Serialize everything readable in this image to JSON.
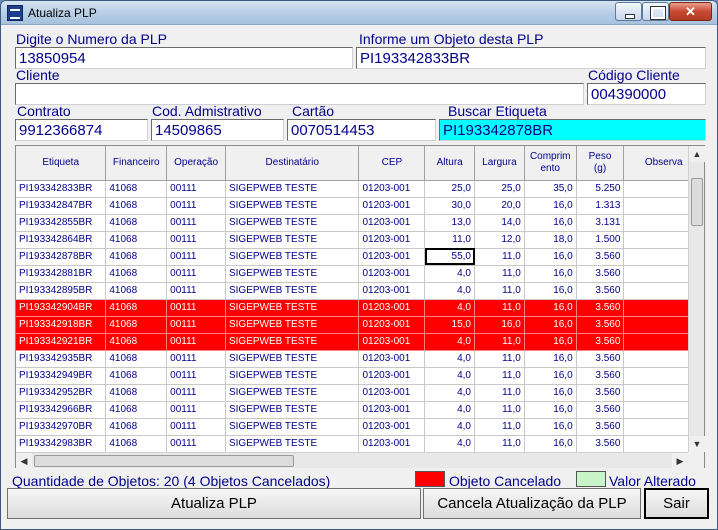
{
  "window": {
    "title": "Atualiza PLP"
  },
  "labels": {
    "plp_number": "Digite o Numero da PLP",
    "object": "Informe um Objeto desta PLP",
    "client": "Cliente",
    "client_code": "Código Cliente",
    "contract": "Contrato",
    "admin_code": "Cod. Admistrativo",
    "card": "Cartão",
    "search_label": "Buscar Etiqueta"
  },
  "fields": {
    "plp_number": "13850954",
    "object": "PI193342833BR",
    "client": "",
    "client_code": "004390000",
    "contract": "9912366874",
    "admin_code": "14509865",
    "card": "0070514453",
    "search_label": "PI193342878BR"
  },
  "table": {
    "columns": [
      {
        "label": "Etiqueta"
      },
      {
        "label": "Financeiro"
      },
      {
        "label": "Operação"
      },
      {
        "label": "Destinatário"
      },
      {
        "label": "CEP"
      },
      {
        "label": "Altura"
      },
      {
        "label": "Largura"
      },
      {
        "label": "Comprimento",
        "display": "Comprim\nento"
      },
      {
        "label": "Peso (g)",
        "display": "Peso\n(g)"
      },
      {
        "label": "Observa"
      }
    ],
    "rows": [
      {
        "cells": [
          "PI193342833BR",
          "41068",
          "00111",
          "SIGEPWEB TESTE",
          "01203-001",
          "25,0",
          "25,0",
          "35,0",
          "5.250",
          ""
        ],
        "status": "normal"
      },
      {
        "cells": [
          "PI193342847BR",
          "41068",
          "00111",
          "SIGEPWEB TESTE",
          "01203-001",
          "30,0",
          "20,0",
          "16,0",
          "1.313",
          ""
        ],
        "status": "normal"
      },
      {
        "cells": [
          "PI193342855BR",
          "41068",
          "00111",
          "SIGEPWEB TESTE",
          "01203-001",
          "13,0",
          "14,0",
          "16,0",
          "3.131",
          ""
        ],
        "status": "normal"
      },
      {
        "cells": [
          "PI193342864BR",
          "41068",
          "00111",
          "SIGEPWEB TESTE",
          "01203-001",
          "11,0",
          "12,0",
          "18,0",
          "1.500",
          ""
        ],
        "status": "normal"
      },
      {
        "cells": [
          "PI193342878BR",
          "41068",
          "00111",
          "SIGEPWEB TESTE",
          "01203-001",
          "55,0",
          "11,0",
          "16,0",
          "3.560",
          ""
        ],
        "status": "normal",
        "selected_col": 5
      },
      {
        "cells": [
          "PI193342881BR",
          "41068",
          "00111",
          "SIGEPWEB TESTE",
          "01203-001",
          "4,0",
          "11,0",
          "16,0",
          "3.560",
          ""
        ],
        "status": "normal"
      },
      {
        "cells": [
          "PI193342895BR",
          "41068",
          "00111",
          "SIGEPWEB TESTE",
          "01203-001",
          "4,0",
          "11,0",
          "16,0",
          "3.560",
          ""
        ],
        "status": "normal"
      },
      {
        "cells": [
          "PI193342904BR",
          "41068",
          "00111",
          "SIGEPWEB TESTE",
          "01203-001",
          "4,0",
          "11,0",
          "16,0",
          "3.560",
          ""
        ],
        "status": "cancelled"
      },
      {
        "cells": [
          "PI193342918BR",
          "41068",
          "00111",
          "SIGEPWEB TESTE",
          "01203-001",
          "15,0",
          "16,0",
          "16,0",
          "3.560",
          ""
        ],
        "status": "cancelled"
      },
      {
        "cells": [
          "PI193342921BR",
          "41068",
          "00111",
          "SIGEPWEB TESTE",
          "01203-001",
          "4,0",
          "11,0",
          "16,0",
          "3.560",
          ""
        ],
        "status": "cancelled"
      },
      {
        "cells": [
          "PI193342935BR",
          "41068",
          "00111",
          "SIGEPWEB TESTE",
          "01203-001",
          "4,0",
          "11,0",
          "16,0",
          "3.560",
          ""
        ],
        "status": "normal"
      },
      {
        "cells": [
          "PI193342949BR",
          "41068",
          "00111",
          "SIGEPWEB TESTE",
          "01203-001",
          "4,0",
          "11,0",
          "16,0",
          "3.560",
          ""
        ],
        "status": "normal"
      },
      {
        "cells": [
          "PI193342952BR",
          "41068",
          "00111",
          "SIGEPWEB TESTE",
          "01203-001",
          "4,0",
          "11,0",
          "16,0",
          "3.560",
          ""
        ],
        "status": "normal"
      },
      {
        "cells": [
          "PI193342966BR",
          "41068",
          "00111",
          "SIGEPWEB TESTE",
          "01203-001",
          "4,0",
          "11,0",
          "16,0",
          "3.560",
          ""
        ],
        "status": "normal"
      },
      {
        "cells": [
          "PI193342970BR",
          "41068",
          "00111",
          "SIGEPWEB TESTE",
          "01203-001",
          "4,0",
          "11,0",
          "16,0",
          "3.560",
          ""
        ],
        "status": "normal"
      },
      {
        "cells": [
          "PI193342983BR",
          "41068",
          "00111",
          "SIGEPWEB TESTE",
          "01203-001",
          "4,0",
          "11,0",
          "16,0",
          "3.560",
          ""
        ],
        "status": "normal"
      }
    ]
  },
  "footer": {
    "summary": "Quantidade de Objetos: 20   (4 Objetos Cancelados)",
    "legend_cancelled": "Objeto Cancelado",
    "legend_changed": "Valor Alterado",
    "cancelled_color": "#ff0000",
    "changed_color": "#c8f5c8"
  },
  "buttons": {
    "update": "Atualiza PLP",
    "cancel": "Cancela Atualização da PLP",
    "exit": "Sair"
  },
  "icons": {
    "app": "correios-app-icon",
    "scroll_up": "▲",
    "scroll_down": "▼",
    "scroll_left": "◀",
    "scroll_right": "▶"
  }
}
